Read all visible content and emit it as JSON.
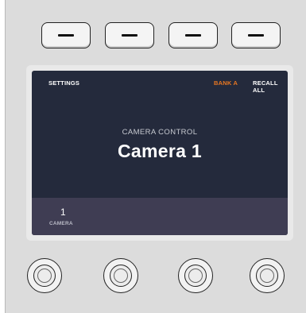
{
  "softkeys": [
    {
      "name": "softkey-1"
    },
    {
      "name": "softkey-2"
    },
    {
      "name": "softkey-3"
    },
    {
      "name": "softkey-4"
    }
  ],
  "lcd": {
    "top_left_label": "SETTINGS",
    "bank_label": "BANK A",
    "recall_label": "RECALL ALL",
    "subtitle": "CAMERA CONTROL",
    "title": "Camera 1",
    "camera_number": "1",
    "camera_label": "CAMERA"
  },
  "colors": {
    "accent": "#e87722",
    "screen_bg": "#242a3c",
    "bottom_bar_bg": "#3f3d53",
    "panel_bg": "#dcdcdc"
  },
  "knobs": [
    {
      "name": "knob-1"
    },
    {
      "name": "knob-2"
    },
    {
      "name": "knob-3"
    },
    {
      "name": "knob-4"
    }
  ]
}
